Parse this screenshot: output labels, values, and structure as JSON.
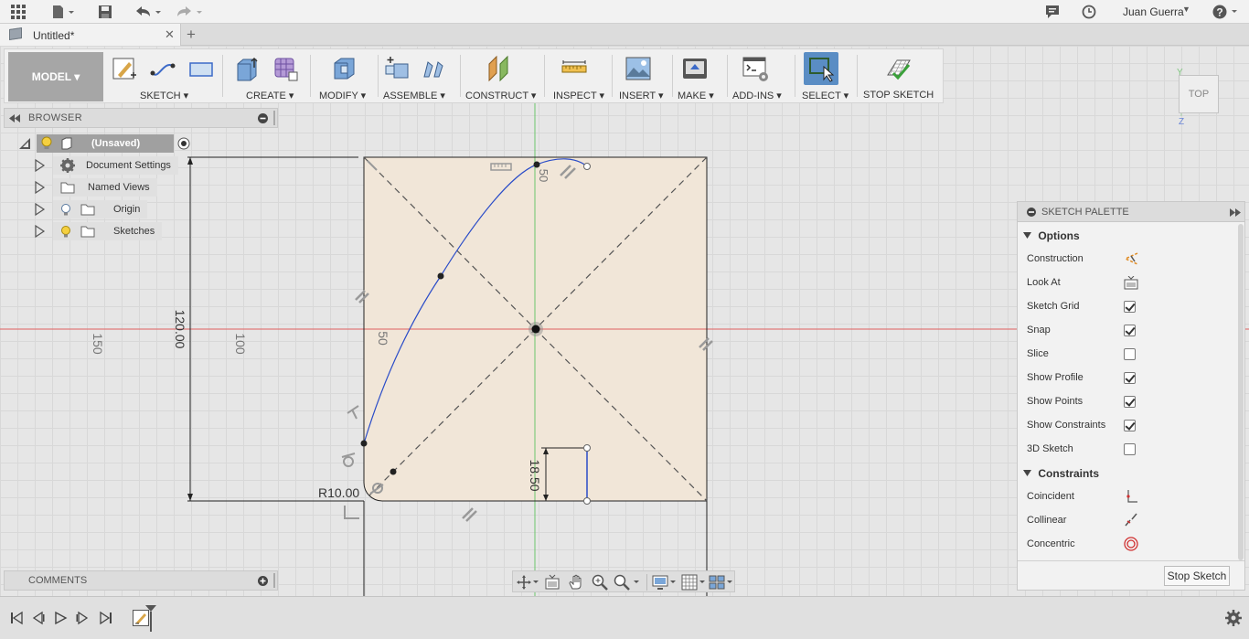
{
  "appbar": {
    "user_name": "Juan Guerra"
  },
  "tab": {
    "title": "Untitled*"
  },
  "toolbar": {
    "workspace": "MODEL ▾",
    "groups": [
      {
        "label": "SKETCH ▾"
      },
      {
        "label": "CREATE ▾"
      },
      {
        "label": "MODIFY ▾"
      },
      {
        "label": "ASSEMBLE ▾"
      },
      {
        "label": "CONSTRUCT ▾"
      },
      {
        "label": "INSPECT ▾"
      },
      {
        "label": "INSERT ▾"
      },
      {
        "label": "MAKE ▾"
      },
      {
        "label": "ADD-INS ▾"
      },
      {
        "label": "SELECT ▾"
      },
      {
        "label": "STOP SKETCH"
      }
    ]
  },
  "browser": {
    "title": "BROWSER",
    "root": "(Unsaved)",
    "items": [
      {
        "label": "Document Settings"
      },
      {
        "label": "Named Views"
      },
      {
        "label": "Origin"
      },
      {
        "label": "Sketches"
      }
    ]
  },
  "comments": {
    "title": "COMMENTS"
  },
  "viewcube": {
    "face": "TOP",
    "axis_y": "Y",
    "axis_z": "Z"
  },
  "sketch": {
    "dim_height": "120.00",
    "dim_fillet": "R10.00",
    "dim_small": "18.50",
    "ruler_labels": [
      "150",
      "100",
      "50",
      "50"
    ]
  },
  "palette": {
    "title": "SKETCH PALETTE",
    "options_title": "Options",
    "options": [
      {
        "label": "Construction",
        "type": "icon"
      },
      {
        "label": "Look At",
        "type": "icon"
      },
      {
        "label": "Sketch Grid",
        "type": "check",
        "checked": true
      },
      {
        "label": "Snap",
        "type": "check",
        "checked": true
      },
      {
        "label": "Slice",
        "type": "check",
        "checked": false
      },
      {
        "label": "Show Profile",
        "type": "check",
        "checked": true
      },
      {
        "label": "Show Points",
        "type": "check",
        "checked": true
      },
      {
        "label": "Show Constraints",
        "type": "check",
        "checked": true
      },
      {
        "label": "3D Sketch",
        "type": "check",
        "checked": false
      }
    ],
    "constraints_title": "Constraints",
    "constraints": [
      {
        "label": "Coincident"
      },
      {
        "label": "Collinear"
      },
      {
        "label": "Concentric"
      }
    ],
    "stop_button": "Stop Sketch"
  }
}
